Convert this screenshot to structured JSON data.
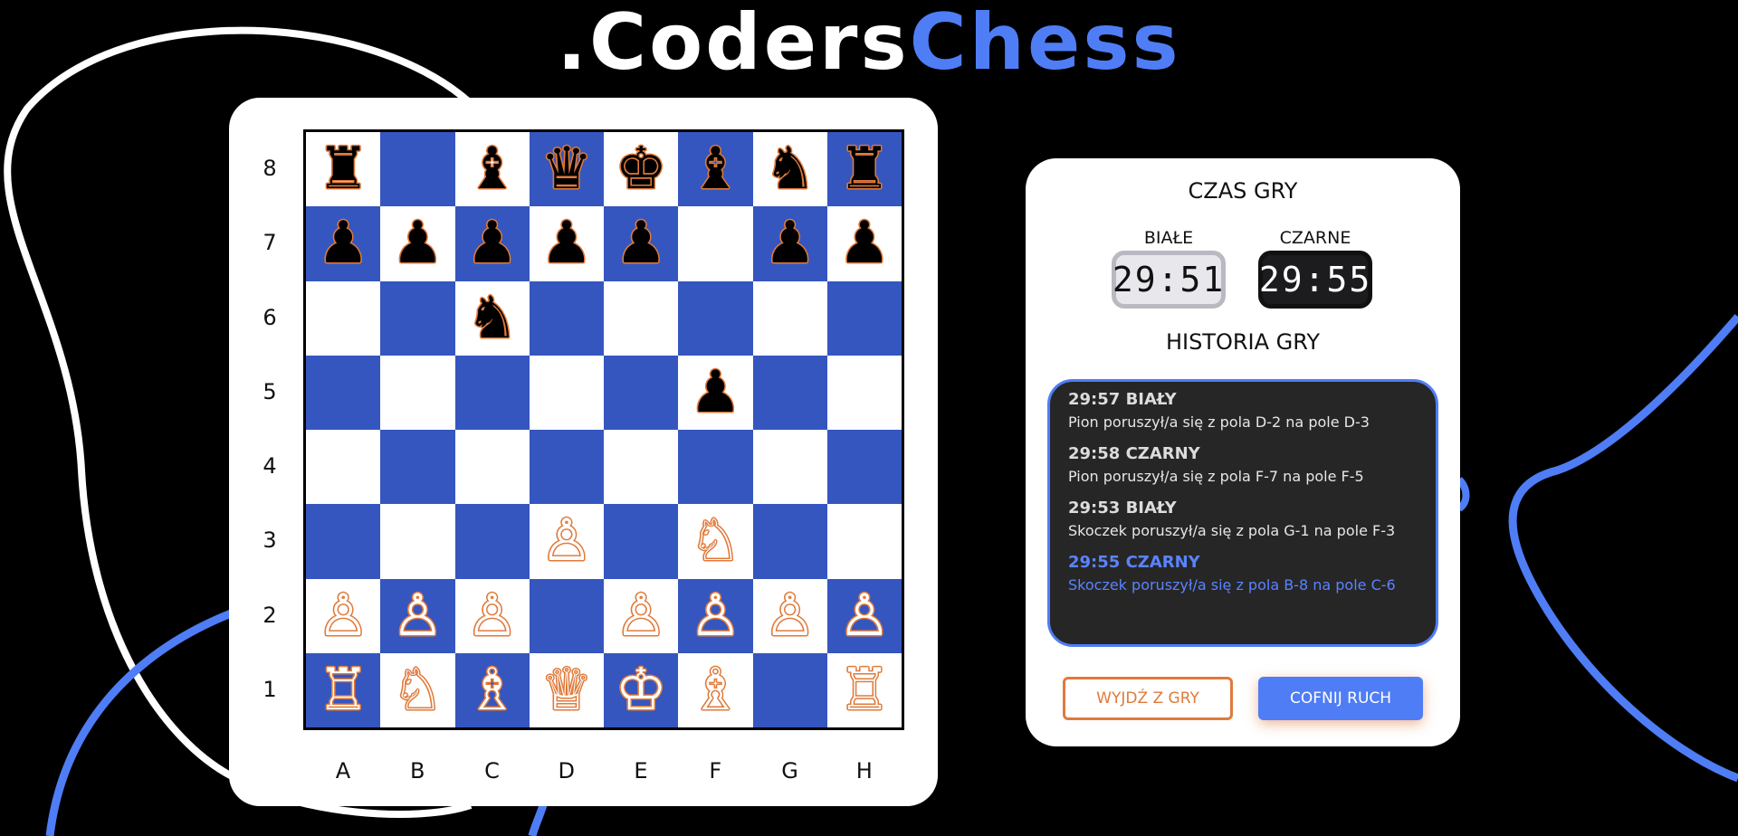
{
  "logo": {
    "part1": ".Coders",
    "part2": "Chess"
  },
  "colors": {
    "accent_blue": "#4f7df5",
    "board_dark": "#3556bf",
    "board_light": "#ffffff",
    "piece_outline": "#e07a3a",
    "history_bg": "#262626"
  },
  "board": {
    "ranks": [
      "8",
      "7",
      "6",
      "5",
      "4",
      "3",
      "2",
      "1"
    ],
    "files": [
      "A",
      "B",
      "C",
      "D",
      "E",
      "F",
      "G",
      "H"
    ],
    "position": [
      [
        "bR",
        "",
        "bB",
        "bQ",
        "bK",
        "bB",
        "bN",
        "bR"
      ],
      [
        "bP",
        "bP",
        "bP",
        "bP",
        "bP",
        "",
        "bP",
        "bP"
      ],
      [
        "",
        "",
        "bN",
        "",
        "",
        "",
        "",
        ""
      ],
      [
        "",
        "",
        "",
        "",
        "",
        "bP",
        "",
        ""
      ],
      [
        "",
        "",
        "",
        "",
        "",
        "",
        "",
        ""
      ],
      [
        "",
        "",
        "",
        "wP",
        "",
        "wN",
        "",
        ""
      ],
      [
        "wP",
        "wP",
        "wP",
        "",
        "wP",
        "wP",
        "wP",
        "wP"
      ],
      [
        "wR",
        "wN",
        "wB",
        "wQ",
        "wK",
        "wB",
        "",
        "wR"
      ]
    ]
  },
  "panel": {
    "time_title": "CZAS GRY",
    "white_label": "BIAŁE",
    "black_label": "CZARNE",
    "white_time": "29:51",
    "black_time": "29:55",
    "history_title": "HISTORIA GRY",
    "history": [
      {
        "head": "29:57 BIAŁY",
        "text": "Pion poruszył/a się z pola D-2 na pole D-3",
        "active": false
      },
      {
        "head": "29:58 CZARNY",
        "text": "Pion poruszył/a się z pola F-7 na pole F-5",
        "active": false
      },
      {
        "head": "29:53 BIAŁY",
        "text": "Skoczek poruszył/a się z pola G-1 na pole F-3",
        "active": false
      },
      {
        "head": "29:55 CZARNY",
        "text": "Skoczek poruszył/a się z pola B-8 na pole C-6",
        "active": true
      }
    ],
    "exit_button": "WYJDŹ Z GRY",
    "undo_button": "COFNIJ RUCH"
  }
}
